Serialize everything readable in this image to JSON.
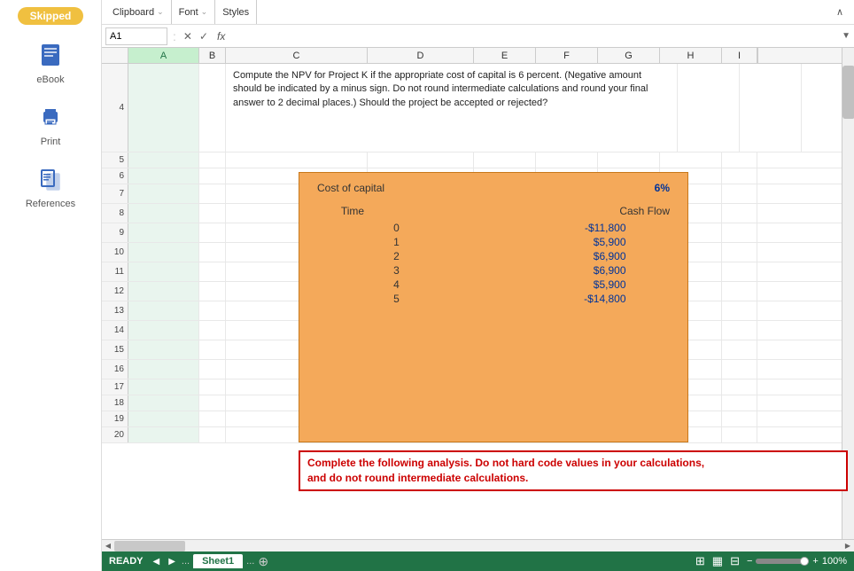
{
  "sidebar": {
    "badge": "Skipped",
    "items": [
      {
        "id": "ebook",
        "label": "eBook"
      },
      {
        "id": "print",
        "label": "Print"
      },
      {
        "id": "references",
        "label": "References"
      }
    ]
  },
  "ribbon": {
    "groups": [
      "Clipboard",
      "Font",
      "Styles"
    ],
    "expand_symbol": "⌄"
  },
  "formula_bar": {
    "cell_ref": "A1",
    "fx_label": "fx",
    "cancel": "✕",
    "confirm": "✓"
  },
  "columns": [
    "A",
    "B",
    "C",
    "D",
    "E",
    "F",
    "G",
    "H",
    "I"
  ],
  "row_numbers": [
    4,
    5,
    6,
    7,
    8,
    9,
    10,
    11,
    12,
    13,
    14,
    15,
    16,
    17,
    18,
    19,
    20
  ],
  "question_text": "Compute the NPV for Project K if the appropriate cost of capital is 6 percent. (Negative amount should be indicated by a minus sign. Do not round intermediate calculations and round your final answer to 2 decimal places.) Should the project be accepted or rejected?",
  "orange_table": {
    "cost_of_capital_label": "Cost of capital",
    "cost_of_capital_value": "6%",
    "time_header": "Time",
    "cashflow_header": "Cash Flow",
    "rows": [
      {
        "time": "0",
        "cashflow": "-$11,800"
      },
      {
        "time": "1",
        "cashflow": "$5,900"
      },
      {
        "time": "2",
        "cashflow": "$6,900"
      },
      {
        "time": "3",
        "cashflow": "$6,900"
      },
      {
        "time": "4",
        "cashflow": "$5,900"
      },
      {
        "time": "5",
        "cashflow": "-$14,800"
      }
    ]
  },
  "red_box": {
    "line1": "Complete the following analysis. Do not hard code values in your calculations,",
    "line2": "and do not round intermediate calculations."
  },
  "status_bar": {
    "ready": "READY",
    "sheet_tab": "Sheet1",
    "zoom": "100%"
  }
}
